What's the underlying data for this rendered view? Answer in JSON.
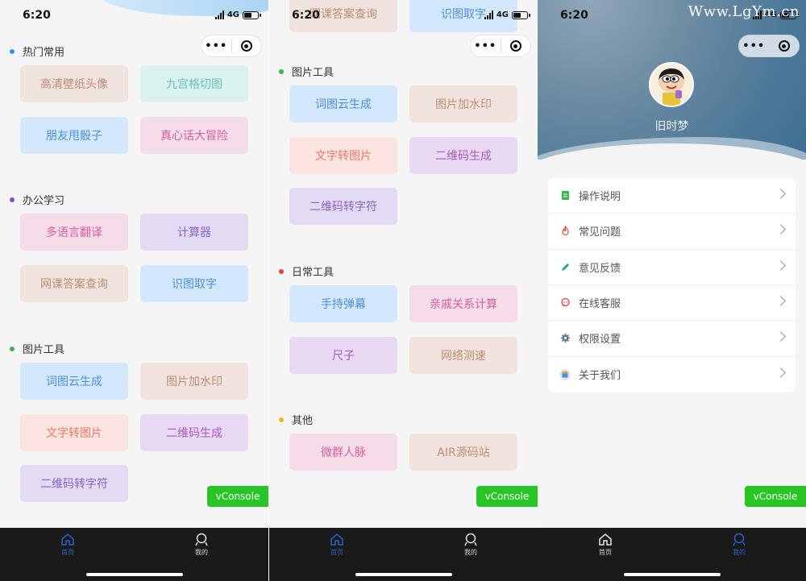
{
  "status": {
    "time": "6:20",
    "network": "4G"
  },
  "capsule": {
    "more": "•••"
  },
  "panel1": {
    "sections": [
      {
        "title": "热门常用",
        "dot": "#3b8df0",
        "items": [
          {
            "label": "高清壁纸头像",
            "color": "peach"
          },
          {
            "label": "九宫格切图",
            "color": "mint"
          },
          {
            "label": "朋友甩骰子",
            "color": "blue"
          },
          {
            "label": "真心话大冒险",
            "color": "pink"
          }
        ]
      },
      {
        "title": "办公学习",
        "dot": "#7b4fc4",
        "items": [
          {
            "label": "多语言翻译",
            "color": "pink"
          },
          {
            "label": "计算器",
            "color": "lav"
          },
          {
            "label": "网课答案查询",
            "color": "peach"
          },
          {
            "label": "识图取字",
            "color": "blue"
          }
        ]
      },
      {
        "title": "图片工具",
        "dot": "#3bb54a",
        "items": [
          {
            "label": "词图云生成",
            "color": "blue"
          },
          {
            "label": "图片加水印",
            "color": "peach"
          },
          {
            "label": "文字转图片",
            "color": "salmon"
          },
          {
            "label": "二维码生成",
            "color": "purple"
          },
          {
            "label": "二维码转字符",
            "color": "lav"
          }
        ]
      }
    ]
  },
  "panel2": {
    "top_items": [
      {
        "label": "网课答案查询",
        "color": "peach"
      },
      {
        "label": "识图取字",
        "color": "blue"
      }
    ],
    "sections": [
      {
        "title": "图片工具",
        "dot": "#3bb54a",
        "items": [
          {
            "label": "词图云生成",
            "color": "blue"
          },
          {
            "label": "图片加水印",
            "color": "peach"
          },
          {
            "label": "文字转图片",
            "color": "salmon"
          },
          {
            "label": "二维码生成",
            "color": "purple"
          },
          {
            "label": "二维码转字符",
            "color": "lav"
          }
        ]
      },
      {
        "title": "日常工具",
        "dot": "#e0443a",
        "items": [
          {
            "label": "手持弹幕",
            "color": "blue"
          },
          {
            "label": "亲戚关系计算",
            "color": "pink"
          },
          {
            "label": "尺子",
            "color": "purple"
          },
          {
            "label": "网络测速",
            "color": "peach"
          }
        ]
      },
      {
        "title": "其他",
        "dot": "#f5b21c",
        "items": [
          {
            "label": "微群人脉",
            "color": "pink"
          },
          {
            "label": "AIR源码站",
            "color": "peach"
          }
        ]
      }
    ]
  },
  "panel3": {
    "watermark": "Www.LgYm.cn",
    "username": "旧时梦",
    "menu": [
      {
        "label": "操作说明",
        "icon": "doc-icon",
        "color": "#3bb54a"
      },
      {
        "label": "常见问题",
        "icon": "flame-icon",
        "color": "#ea5a3c"
      },
      {
        "label": "意见反馈",
        "icon": "pencil-icon",
        "color": "#17a58c"
      },
      {
        "label": "在线客服",
        "icon": "chat-icon",
        "color": "#e0443a"
      },
      {
        "label": "权限设置",
        "icon": "gear-icon",
        "color": "#607a90"
      },
      {
        "label": "关于我们",
        "icon": "shop-icon",
        "color": "#4a90d9"
      }
    ]
  },
  "vconsole": "vConsole",
  "tabbar": {
    "home": "首页",
    "mine": "我的"
  },
  "colors": {
    "active_tab": "#2a60c8",
    "vconsole": "#04be02"
  }
}
